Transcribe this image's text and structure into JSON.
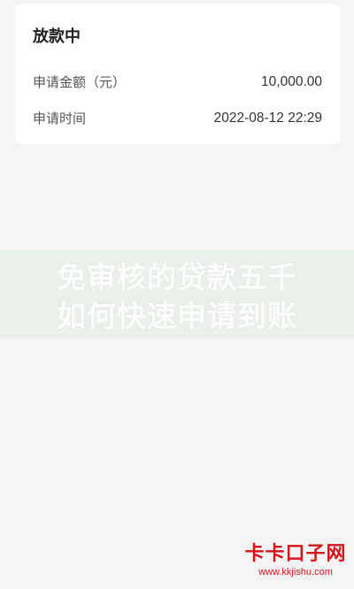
{
  "card": {
    "title": "放款中",
    "rows": [
      {
        "label": "申请金额（元）",
        "value": "10,000.00"
      },
      {
        "label": "申请时间",
        "value": "2022-08-12 22:29"
      }
    ]
  },
  "watermark": {
    "line1": "免审核的贷款五千",
    "line2": "如何快速申请到账"
  },
  "site": {
    "name": "卡卡口子网",
    "url": "www.kkjishu.com"
  },
  "colors": {
    "background": "#f4f4f4",
    "card": "#ffffff",
    "brand_red": "#d4141c"
  }
}
